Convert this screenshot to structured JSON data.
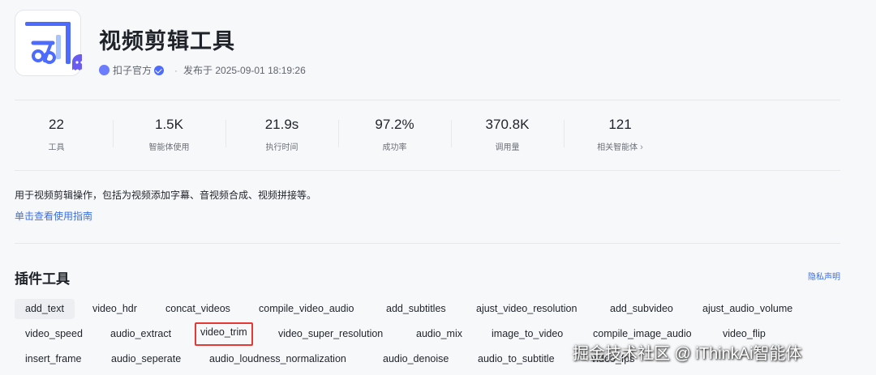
{
  "app": {
    "title": "视频剪辑工具",
    "publisher": "扣子官方",
    "separator": "·",
    "published": "发布于 2025-09-01 18:19:26",
    "brand_color": "#4d6bfe"
  },
  "stats": [
    {
      "value": "22",
      "label": "工具"
    },
    {
      "value": "1.5K",
      "label": "智能体使用"
    },
    {
      "value": "21.9s",
      "label": "执行时间"
    },
    {
      "value": "97.2%",
      "label": "成功率"
    },
    {
      "value": "370.8K",
      "label": "调用量"
    },
    {
      "value": "121",
      "label": "相关智能体",
      "chevron": "›"
    }
  ],
  "description": "用于视频剪辑操作，包括为视频添加字幕、音视频合成、视频拼接等。",
  "guide_link": "单击查看使用指南",
  "plugin_section": {
    "title": "插件工具",
    "privacy_link": "隐私声明",
    "tools_row1": [
      "add_text",
      "video_hdr",
      "concat_videos",
      "compile_video_audio",
      "add_subtitles",
      "ajust_video_resolution",
      "add_subvideo",
      "ajust_audio_volume"
    ],
    "tools_row2": [
      "video_speed",
      "audio_extract",
      "video_trim",
      "video_super_resolution",
      "audio_mix",
      "image_to_video",
      "compile_image_audio",
      "video_flip"
    ],
    "tools_row3": [
      "insert_frame",
      "audio_seperate",
      "audio_loudness_normalization",
      "audio_denoise",
      "audio_to_subtitle",
      "video_fps"
    ],
    "selected_tool": "add_text",
    "highlighted_tool": "video_trim",
    "highlight_color": "#e53935"
  },
  "watermark": "掘金技术社区 @ iThinkAi智能体"
}
